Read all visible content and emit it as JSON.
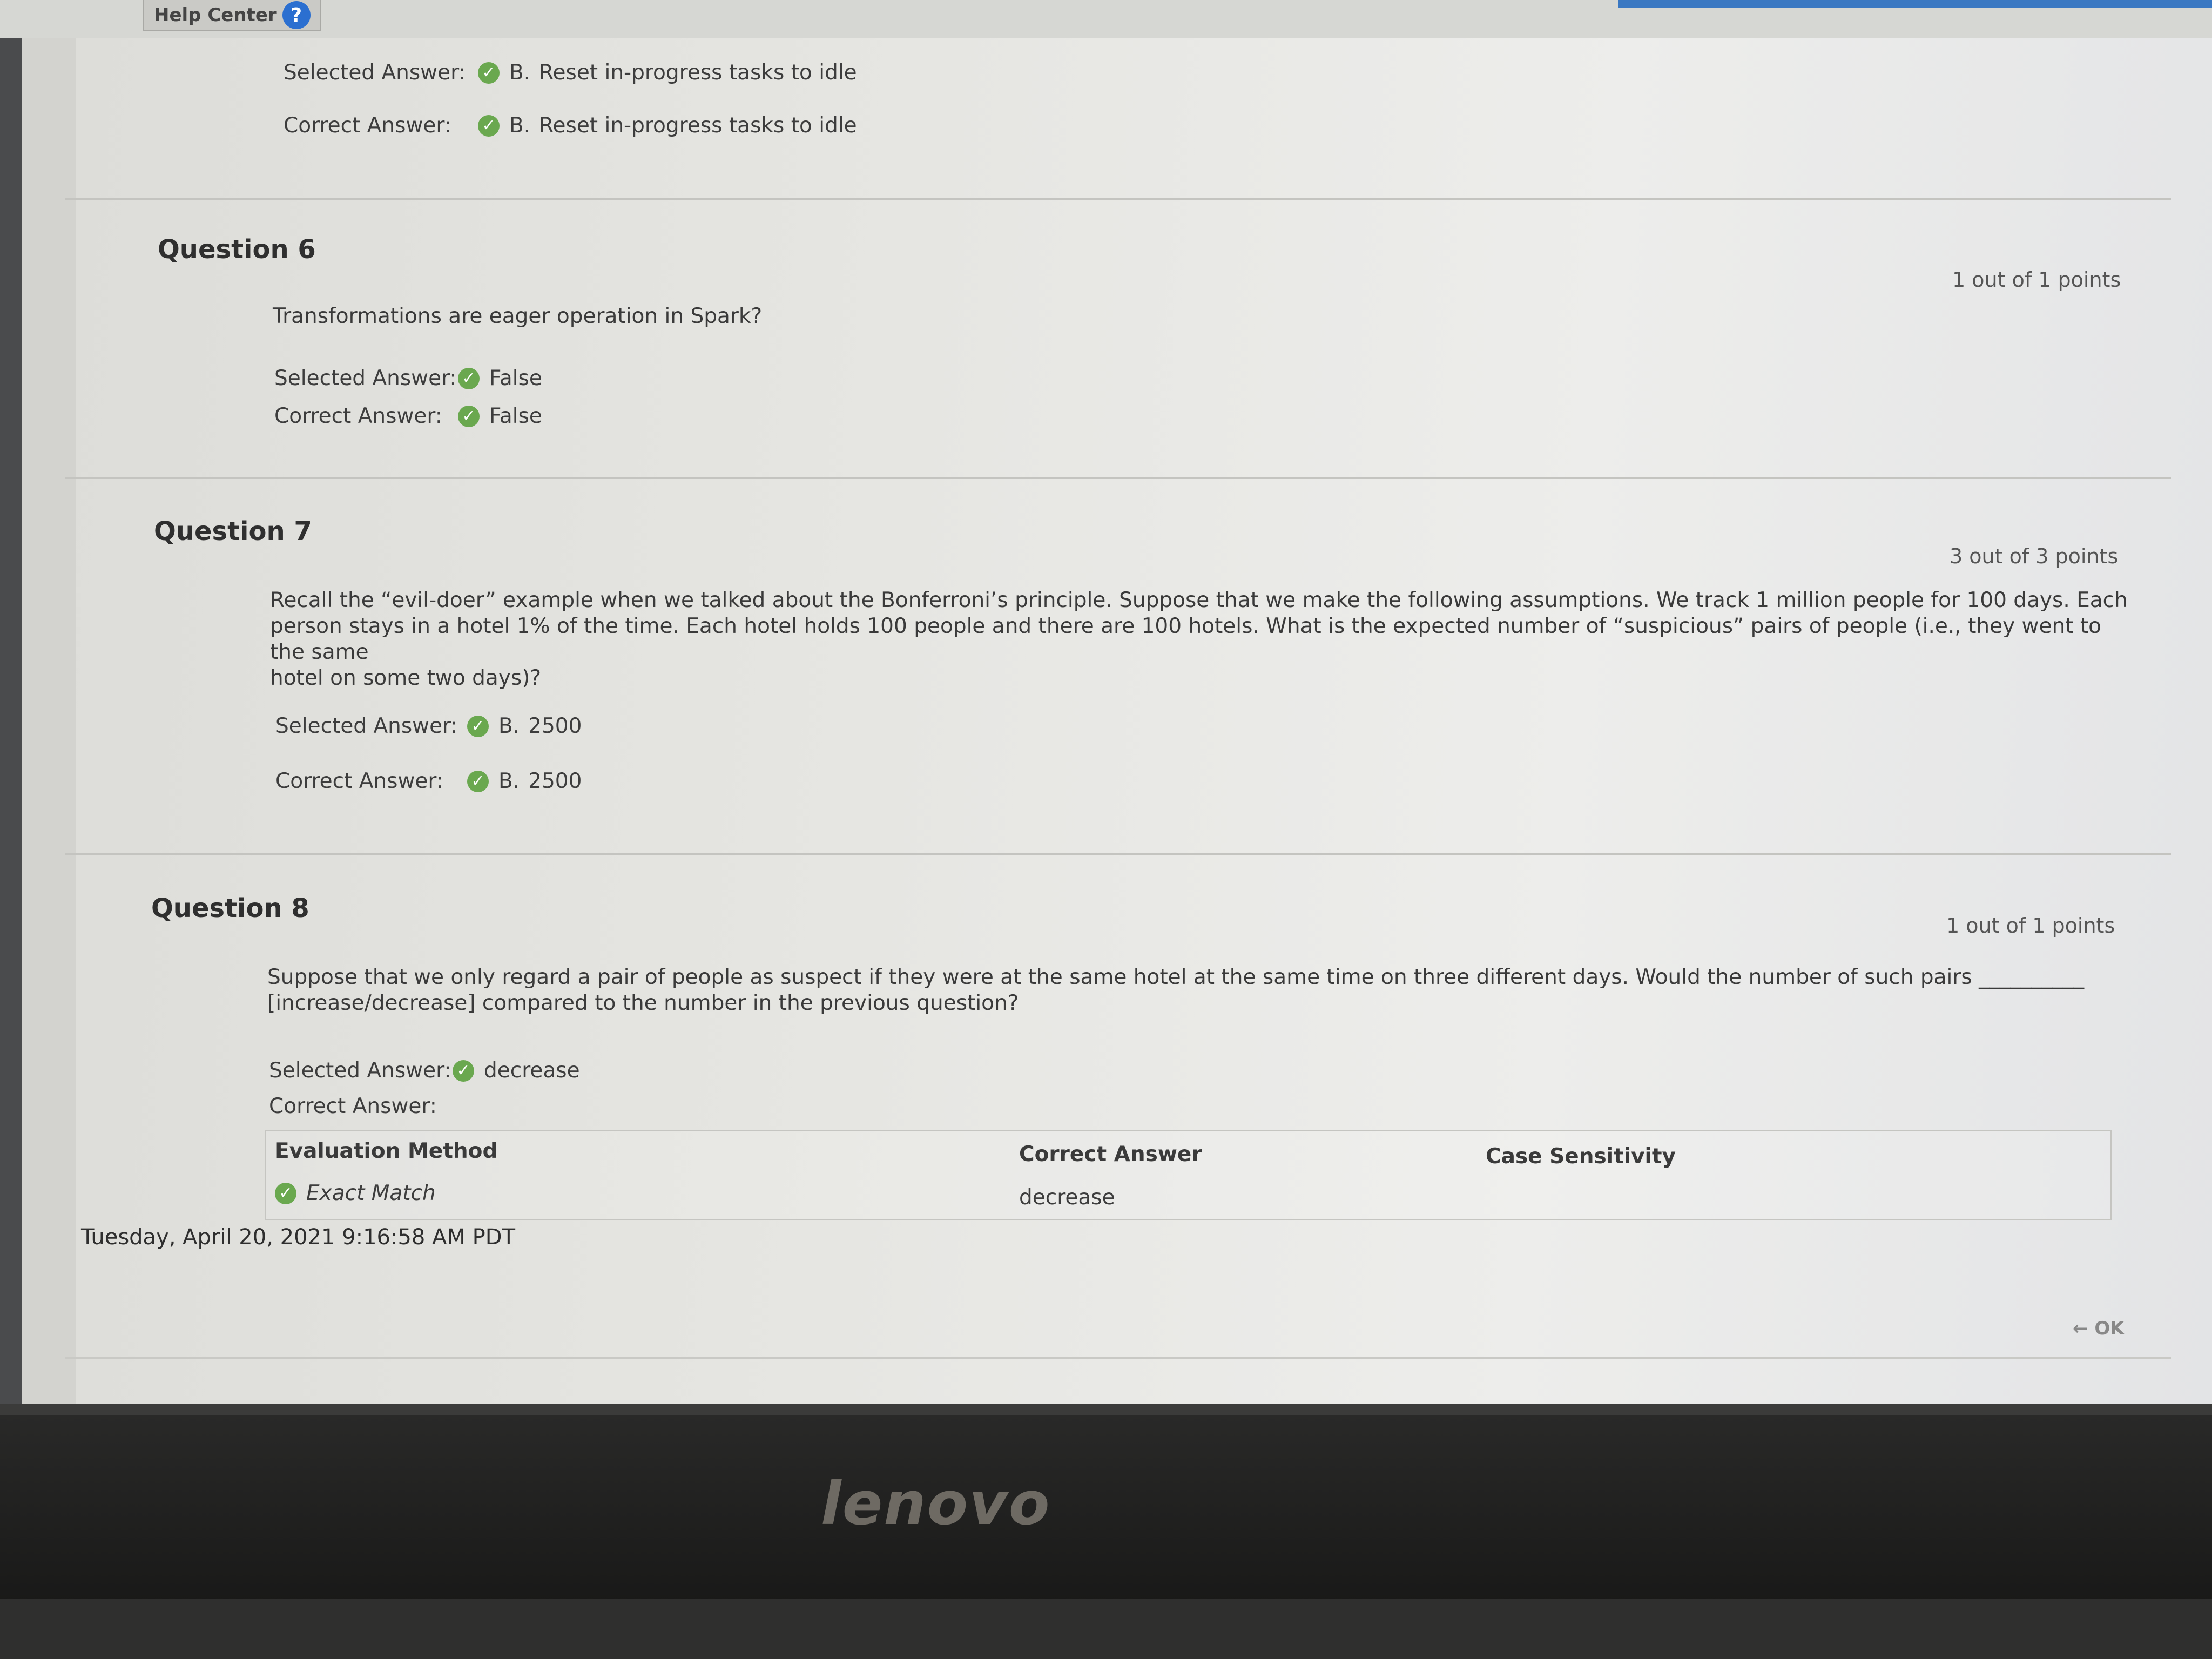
{
  "header": {
    "help_center": "Help Center",
    "help_icon": "question-icon"
  },
  "question5_tail": {
    "selected_label": "Selected Answer:",
    "selected_letter": "B.",
    "selected_value": "Reset in-progress tasks to idle",
    "correct_label": "Correct Answer:",
    "correct_letter": "B.",
    "correct_value": "Reset in-progress tasks to idle"
  },
  "question6": {
    "title": "Question 6",
    "points": "1 out of 1 points",
    "text": "Transformations are eager operation in Spark?",
    "selected_label": "Selected Answer:",
    "selected_value": "False",
    "correct_label": "Correct Answer:",
    "correct_value": "False"
  },
  "question7": {
    "title": "Question 7",
    "points": "3 out of 3 points",
    "text_line1": "Recall the “evil-doer” example when we talked about the Bonferroni’s principle. Suppose that we make the following assumptions. We track 1 million people for 100 days. Each",
    "text_line2": "person stays in a hotel 1% of the time. Each hotel holds 100 people and there are 100 hotels. What is the expected number of “suspicious” pairs of people (i.e., they went to the same",
    "text_line3": "hotel on some two days)?",
    "selected_label": "Selected Answer:",
    "selected_letter": "B.",
    "selected_value": "2500",
    "correct_label": "Correct Answer:",
    "correct_letter": "B.",
    "correct_value": "2500"
  },
  "question8": {
    "title": "Question 8",
    "points": "1 out of 1 points",
    "text_line1": "Suppose that we only regard a pair of people as suspect if they were at the same hotel at the same time on three different days. Would the number of such pairs __________",
    "text_line2": "[increase/decrease] compared to the number in the previous question?",
    "selected_label": "Selected Answer:",
    "selected_value": "decrease",
    "correct_label": "Correct Answer:",
    "table": {
      "headers": [
        "Evaluation Method",
        "Correct Answer",
        "Case Sensitivity"
      ],
      "row": [
        "Exact Match",
        "decrease",
        ""
      ]
    }
  },
  "footer": {
    "timestamp": "Tuesday, April 20, 2021 9:16:58 AM PDT",
    "ok": "← OK"
  },
  "device": {
    "brand": "lenovo"
  },
  "colors": {
    "check": "#6aa84f",
    "help_icon": "#2b6fd0"
  }
}
